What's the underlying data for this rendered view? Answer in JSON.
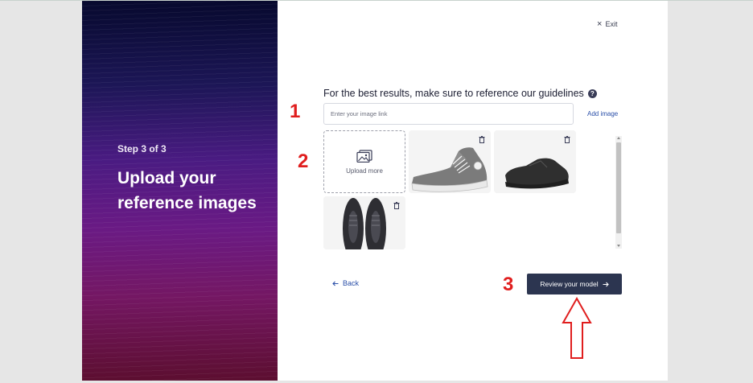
{
  "side_panel": {
    "step": "Step 3 of 3",
    "title": "Upload your reference images"
  },
  "header": {
    "exit_label": "Exit"
  },
  "guidelines": {
    "heading": "For the best results, make sure to reference our guidelines",
    "help_icon": "?"
  },
  "image_link": {
    "placeholder": "Enter your image link",
    "value": "",
    "add_label": "Add image"
  },
  "gallery": {
    "upload_label": "Upload more",
    "images": [
      {
        "name": "grey-high-top-sneaker",
        "icon": "trash-icon"
      },
      {
        "name": "black-leather-sneaker",
        "icon": "trash-icon"
      },
      {
        "name": "black-sneakers-top-view",
        "icon": "trash-icon"
      }
    ]
  },
  "footer": {
    "back_label": "Back",
    "review_label": "Review your model"
  },
  "annotations": {
    "one": "1",
    "two": "2",
    "three": "3",
    "color": "#e01e1e"
  },
  "colors": {
    "primary_button": "#2c3550",
    "link": "#2a4fa8",
    "annotation": "#e01e1e"
  }
}
